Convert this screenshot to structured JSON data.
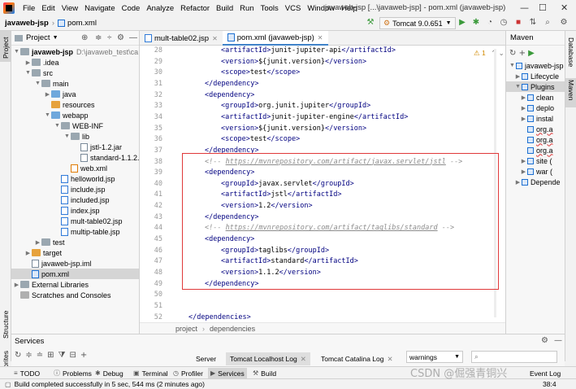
{
  "menubar": {
    "items": [
      "File",
      "Edit",
      "View",
      "Navigate",
      "Code",
      "Analyze",
      "Refactor",
      "Build",
      "Run",
      "Tools",
      "VCS",
      "Window",
      "Help"
    ],
    "title": "javaweb-jsp [...\\javaweb-jsp] - pom.xml (javaweb-jsp)"
  },
  "navbar": {
    "project": "javaweb-jsp",
    "file": "pom.xml",
    "run_config": "Tomcat 9.0.651"
  },
  "project_panel": {
    "title": "Project",
    "root_label": "javaweb-jsp",
    "root_path": "D:\\javaweb_test\\ca",
    "items": {
      "idea": ".idea",
      "src": "src",
      "main": "main",
      "java": "java",
      "resources": "resources",
      "webapp": "webapp",
      "webinf": "WEB-INF",
      "lib": "lib",
      "jstl": "jstl-1.2.jar",
      "standard": "standard-1.1.2.",
      "webxml": "web.xml",
      "helloworld": "helloworld.jsp",
      "include": "include.jsp",
      "included": "included.jsp",
      "index": "index.jsp",
      "multtable02": "mult-table02.jsp",
      "multiptable": "multip-table.jsp",
      "test": "test",
      "target": "target",
      "iml": "javaweb-jsp.iml",
      "pom": "pom.xml",
      "extlibs": "External Libraries",
      "scratches": "Scratches and Consoles"
    }
  },
  "editor": {
    "tabs": [
      "mult-table02.jsp",
      "pom.xml (javaweb-jsp)"
    ],
    "breadcrumb": [
      "project",
      "dependencies"
    ],
    "warning_count": "1",
    "lines": [
      {
        "n": "28",
        "segs": [
          [
            "tg",
            "<artifactId>"
          ],
          [
            "tx",
            "junit-jupiter-api"
          ],
          [
            "tg",
            "</artifactId>"
          ]
        ],
        "indent": 3
      },
      {
        "n": "29",
        "segs": [
          [
            "tg",
            "<version>"
          ],
          [
            "tx",
            "${junit.version}"
          ],
          [
            "tg",
            "</version>"
          ]
        ],
        "indent": 3
      },
      {
        "n": "30",
        "segs": [
          [
            "tg",
            "<scope>"
          ],
          [
            "tx",
            "test"
          ],
          [
            "tg",
            "</scope>"
          ]
        ],
        "indent": 3
      },
      {
        "n": "31",
        "segs": [
          [
            "tg",
            "</dependency>"
          ]
        ],
        "indent": 2
      },
      {
        "n": "32",
        "segs": [
          [
            "tg",
            "<dependency>"
          ]
        ],
        "indent": 2
      },
      {
        "n": "33",
        "segs": [
          [
            "tg",
            "<groupId>"
          ],
          [
            "tx",
            "org.junit.jupiter"
          ],
          [
            "tg",
            "</groupId>"
          ]
        ],
        "indent": 3
      },
      {
        "n": "34",
        "segs": [
          [
            "tg",
            "<artifactId>"
          ],
          [
            "tx",
            "junit-jupiter-engine"
          ],
          [
            "tg",
            "</artifactId>"
          ]
        ],
        "indent": 3
      },
      {
        "n": "35",
        "segs": [
          [
            "tg",
            "<version>"
          ],
          [
            "tx",
            "${junit.version}"
          ],
          [
            "tg",
            "</version>"
          ]
        ],
        "indent": 3
      },
      {
        "n": "36",
        "segs": [
          [
            "tg",
            "<scope>"
          ],
          [
            "tx",
            "test"
          ],
          [
            "tg",
            "</scope>"
          ]
        ],
        "indent": 3
      },
      {
        "n": "37",
        "segs": [
          [
            "tg",
            "</dependency>"
          ]
        ],
        "indent": 2
      },
      {
        "n": "38",
        "segs": [
          [
            "cm",
            "<!-- "
          ],
          [
            "url",
            "https://mvnrepository.com/artifact/javax.servlet/jstl"
          ],
          [
            "cm",
            " -->"
          ]
        ],
        "indent": 2
      },
      {
        "n": "39",
        "segs": [
          [
            "tg",
            "<dependency>"
          ]
        ],
        "indent": 2
      },
      {
        "n": "40",
        "segs": [
          [
            "tg",
            "<groupId>"
          ],
          [
            "tx",
            "javax.servlet"
          ],
          [
            "tg",
            "</groupId>"
          ]
        ],
        "indent": 3
      },
      {
        "n": "41",
        "segs": [
          [
            "tg",
            "<artifactId>"
          ],
          [
            "tx",
            "jstl"
          ],
          [
            "tg",
            "</artifactId>"
          ]
        ],
        "indent": 3
      },
      {
        "n": "42",
        "segs": [
          [
            "tg",
            "<version>"
          ],
          [
            "tx",
            "1.2"
          ],
          [
            "tg",
            "</version>"
          ]
        ],
        "indent": 3
      },
      {
        "n": "43",
        "segs": [
          [
            "tg",
            "</dependency>"
          ]
        ],
        "indent": 2
      },
      {
        "n": "44",
        "segs": [
          [
            "cm",
            "<!-- "
          ],
          [
            "url",
            "https://mvnrepository.com/artifact/taglibs/standard"
          ],
          [
            "cm",
            " -->"
          ]
        ],
        "indent": 2
      },
      {
        "n": "45",
        "segs": [
          [
            "tg",
            "<dependency>"
          ]
        ],
        "indent": 2
      },
      {
        "n": "46",
        "segs": [
          [
            "tg",
            "<groupId>"
          ],
          [
            "tx",
            "taglibs"
          ],
          [
            "tg",
            "</groupId>"
          ]
        ],
        "indent": 3
      },
      {
        "n": "47",
        "segs": [
          [
            "tg",
            "<artifactId>"
          ],
          [
            "tx",
            "standard"
          ],
          [
            "tg",
            "</artifactId>"
          ]
        ],
        "indent": 3
      },
      {
        "n": "48",
        "segs": [
          [
            "tg",
            "<version>"
          ],
          [
            "tx",
            "1.1.2"
          ],
          [
            "tg",
            "</version>"
          ]
        ],
        "indent": 3
      },
      {
        "n": "49",
        "segs": [
          [
            "tg",
            "</dependency>"
          ]
        ],
        "indent": 2
      },
      {
        "n": "50",
        "segs": [],
        "indent": 0
      },
      {
        "n": "51",
        "segs": [],
        "indent": 0
      },
      {
        "n": "52",
        "segs": [
          [
            "tg",
            "</dependencies>"
          ]
        ],
        "indent": 1
      }
    ]
  },
  "maven": {
    "title": "Maven",
    "items": [
      "javaweb-jsp",
      "Lifecycle",
      "Plugins",
      "clean",
      "deplo",
      "instal",
      "org.a",
      "org.a",
      "org.a",
      "site (",
      "war (",
      "Depende"
    ]
  },
  "right_strip": [
    "Database",
    "Maven"
  ],
  "left_strip": [
    "Project",
    "Structure",
    "Favorites"
  ],
  "services": {
    "title": "Services",
    "tabs": [
      "Server",
      "Tomcat Localhost Log",
      "Tomcat Catalina Log"
    ],
    "filter_value": "warnings"
  },
  "tool_tabs": [
    "TODO",
    "Problems",
    "Debug",
    "Terminal",
    "Profiler",
    "Services",
    "Build",
    "Event Log"
  ],
  "status": {
    "message": "Build completed successfully in 5 sec, 544 ms (2 minutes ago)",
    "position": "38:4"
  },
  "watermark": "CSDN @倔强青铜兴",
  "colors": {
    "highlight_border": "#e0393a",
    "tag": "#000080",
    "comment": "#8c8c8c",
    "accent": "#4083c9"
  }
}
